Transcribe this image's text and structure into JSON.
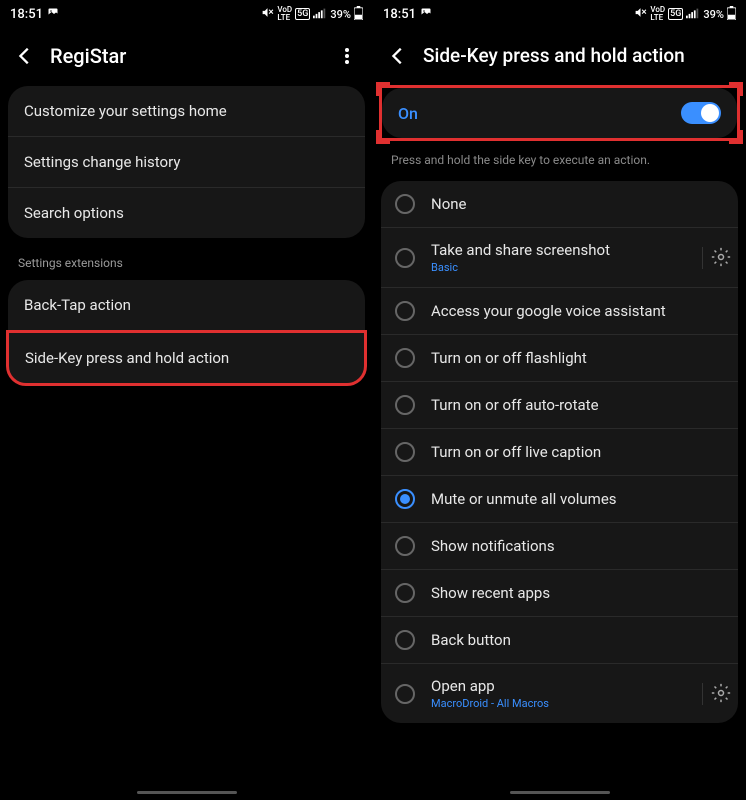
{
  "left": {
    "status": {
      "time": "18:51",
      "battery": "39%"
    },
    "title": "RegiStar",
    "items": [
      "Customize your settings home",
      "Settings change history",
      "Search options"
    ],
    "section_header": "Settings extensions",
    "extensions": [
      "Back-Tap action",
      "Side-Key press and hold action"
    ]
  },
  "right": {
    "status": {
      "time": "18:51",
      "battery": "39%"
    },
    "title": "Side-Key press and hold action",
    "toggle_label": "On",
    "subtitle": "Press and hold the side key to execute an action.",
    "options": [
      {
        "label": "None",
        "sub": "",
        "selected": false,
        "gear": false
      },
      {
        "label": "Take and share screenshot",
        "sub": "Basic",
        "selected": false,
        "gear": true
      },
      {
        "label": "Access your google voice assistant",
        "sub": "",
        "selected": false,
        "gear": false
      },
      {
        "label": "Turn on or off flashlight",
        "sub": "",
        "selected": false,
        "gear": false
      },
      {
        "label": "Turn on or off auto-rotate",
        "sub": "",
        "selected": false,
        "gear": false
      },
      {
        "label": "Turn on or off live caption",
        "sub": "",
        "selected": false,
        "gear": false
      },
      {
        "label": "Mute or unmute all volumes",
        "sub": "",
        "selected": true,
        "gear": false
      },
      {
        "label": "Show notifications",
        "sub": "",
        "selected": false,
        "gear": false
      },
      {
        "label": "Show recent apps",
        "sub": "",
        "selected": false,
        "gear": false
      },
      {
        "label": "Back button",
        "sub": "",
        "selected": false,
        "gear": false
      },
      {
        "label": "Open app",
        "sub": "MacroDroid - All Macros",
        "selected": false,
        "gear": true
      }
    ]
  }
}
